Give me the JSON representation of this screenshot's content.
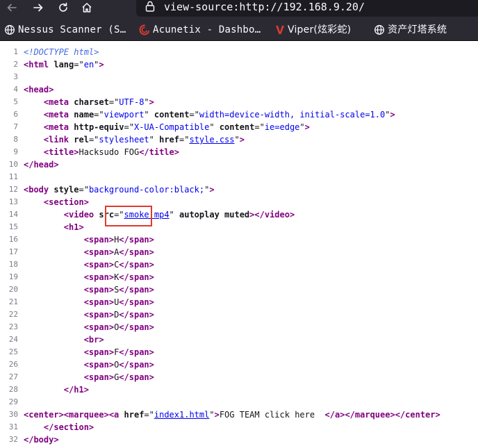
{
  "browser": {
    "url": "view-source:http://192.168.9.20/",
    "bookmarks": [
      {
        "label": "Nessus Scanner (S…",
        "icon": "globe-icon"
      },
      {
        "label": "Acunetix - Dashbo…",
        "icon": "acunetix-icon"
      },
      {
        "label": "Viper(炫彩蛇)",
        "icon": "viper-icon"
      },
      {
        "label": "资产灯塔系统",
        "icon": "globe-icon"
      }
    ]
  },
  "colors": {
    "tag": "#800080",
    "attr_value": "#0000ee",
    "doctype": "#4169e1",
    "highlight": "#e03a2f"
  },
  "source": {
    "lines": [
      {
        "n": "1",
        "tokens": [
          [
            "doctype",
            "<!DOCTYPE html>"
          ]
        ]
      },
      {
        "n": "2",
        "tokens": [
          [
            "tag",
            "<html "
          ],
          [
            "attr",
            "lang"
          ],
          [
            "txt",
            "=\""
          ],
          [
            "val",
            "en"
          ],
          [
            "txt",
            "\""
          ],
          [
            "tag",
            ">"
          ]
        ]
      },
      {
        "n": "3",
        "tokens": []
      },
      {
        "n": "4",
        "tokens": [
          [
            "tag",
            "<head>"
          ]
        ]
      },
      {
        "n": "5",
        "tokens": [
          [
            "txt",
            "    "
          ],
          [
            "tag",
            "<meta "
          ],
          [
            "attr",
            "charset"
          ],
          [
            "txt",
            "=\""
          ],
          [
            "val",
            "UTF-8"
          ],
          [
            "txt",
            "\""
          ],
          [
            "tag",
            ">"
          ]
        ]
      },
      {
        "n": "6",
        "tokens": [
          [
            "txt",
            "    "
          ],
          [
            "tag",
            "<meta "
          ],
          [
            "attr",
            "name"
          ],
          [
            "txt",
            "=\""
          ],
          [
            "val",
            "viewport"
          ],
          [
            "txt",
            "\" "
          ],
          [
            "attr",
            "content"
          ],
          [
            "txt",
            "=\""
          ],
          [
            "val",
            "width=device-width, initial-scale=1.0"
          ],
          [
            "txt",
            "\""
          ],
          [
            "tag",
            ">"
          ]
        ]
      },
      {
        "n": "7",
        "tokens": [
          [
            "txt",
            "    "
          ],
          [
            "tag",
            "<meta "
          ],
          [
            "attr",
            "http-equiv"
          ],
          [
            "txt",
            "=\""
          ],
          [
            "val",
            "X-UA-Compatible"
          ],
          [
            "txt",
            "\" "
          ],
          [
            "attr",
            "content"
          ],
          [
            "txt",
            "=\""
          ],
          [
            "val",
            "ie=edge"
          ],
          [
            "txt",
            "\""
          ],
          [
            "tag",
            ">"
          ]
        ]
      },
      {
        "n": "8",
        "tokens": [
          [
            "txt",
            "    "
          ],
          [
            "tag",
            "<link "
          ],
          [
            "attr",
            "rel"
          ],
          [
            "txt",
            "=\""
          ],
          [
            "val",
            "stylesheet"
          ],
          [
            "txt",
            "\" "
          ],
          [
            "attr",
            "href"
          ],
          [
            "txt",
            "=\""
          ],
          [
            "link",
            "style.css"
          ],
          [
            "txt",
            "\""
          ],
          [
            "tag",
            ">"
          ]
        ]
      },
      {
        "n": "9",
        "tokens": [
          [
            "txt",
            "    "
          ],
          [
            "tag",
            "<title>"
          ],
          [
            "txt",
            "Hacksudo FOG"
          ],
          [
            "tag",
            "</title>"
          ]
        ]
      },
      {
        "n": "10",
        "tokens": [
          [
            "tag",
            "</head>"
          ]
        ]
      },
      {
        "n": "11",
        "tokens": []
      },
      {
        "n": "12",
        "tokens": [
          [
            "tag",
            "<body "
          ],
          [
            "attr",
            "style"
          ],
          [
            "txt",
            "=\""
          ],
          [
            "val",
            "background-color:black;"
          ],
          [
            "txt",
            "\""
          ],
          [
            "tag",
            ">"
          ]
        ]
      },
      {
        "n": "13",
        "tokens": [
          [
            "txt",
            "    "
          ],
          [
            "tag",
            "<section>"
          ]
        ]
      },
      {
        "n": "14",
        "tokens": [
          [
            "txt",
            "        "
          ],
          [
            "tag",
            "<video "
          ],
          [
            "attr",
            "src"
          ],
          [
            "txt",
            "=\""
          ],
          [
            "link",
            "smoke.mp4"
          ],
          [
            "txt",
            "\" "
          ],
          [
            "attr",
            "autoplay muted"
          ],
          [
            "tag",
            ">"
          ],
          [
            "tag",
            "</video>"
          ]
        ]
      },
      {
        "n": "15",
        "tokens": [
          [
            "txt",
            "        "
          ],
          [
            "tag",
            "<h1>"
          ]
        ]
      },
      {
        "n": "16",
        "tokens": [
          [
            "txt",
            "            "
          ],
          [
            "tag",
            "<span>"
          ],
          [
            "txt",
            "H"
          ],
          [
            "tag",
            "</span>"
          ]
        ]
      },
      {
        "n": "17",
        "tokens": [
          [
            "txt",
            "            "
          ],
          [
            "tag",
            "<span>"
          ],
          [
            "txt",
            "A"
          ],
          [
            "tag",
            "</span>"
          ]
        ]
      },
      {
        "n": "18",
        "tokens": [
          [
            "txt",
            "            "
          ],
          [
            "tag",
            "<span>"
          ],
          [
            "txt",
            "C"
          ],
          [
            "tag",
            "</span>"
          ]
        ]
      },
      {
        "n": "19",
        "tokens": [
          [
            "txt",
            "            "
          ],
          [
            "tag",
            "<span>"
          ],
          [
            "txt",
            "K"
          ],
          [
            "tag",
            "</span>"
          ]
        ]
      },
      {
        "n": "20",
        "tokens": [
          [
            "txt",
            "            "
          ],
          [
            "tag",
            "<span>"
          ],
          [
            "txt",
            "S"
          ],
          [
            "tag",
            "</span>"
          ]
        ]
      },
      {
        "n": "21",
        "tokens": [
          [
            "txt",
            "            "
          ],
          [
            "tag",
            "<span>"
          ],
          [
            "txt",
            "U"
          ],
          [
            "tag",
            "</span>"
          ]
        ]
      },
      {
        "n": "22",
        "tokens": [
          [
            "txt",
            "            "
          ],
          [
            "tag",
            "<span>"
          ],
          [
            "txt",
            "D"
          ],
          [
            "tag",
            "</span>"
          ]
        ]
      },
      {
        "n": "23",
        "tokens": [
          [
            "txt",
            "            "
          ],
          [
            "tag",
            "<span>"
          ],
          [
            "txt",
            "O"
          ],
          [
            "tag",
            "</span>"
          ]
        ]
      },
      {
        "n": "24",
        "tokens": [
          [
            "txt",
            "            "
          ],
          [
            "tag",
            "<br>"
          ]
        ]
      },
      {
        "n": "25",
        "tokens": [
          [
            "txt",
            "            "
          ],
          [
            "tag",
            "<span>"
          ],
          [
            "txt",
            "F"
          ],
          [
            "tag",
            "</span>"
          ]
        ]
      },
      {
        "n": "26",
        "tokens": [
          [
            "txt",
            "            "
          ],
          [
            "tag",
            "<span>"
          ],
          [
            "txt",
            "O"
          ],
          [
            "tag",
            "</span>"
          ]
        ]
      },
      {
        "n": "27",
        "tokens": [
          [
            "txt",
            "            "
          ],
          [
            "tag",
            "<span>"
          ],
          [
            "txt",
            "G"
          ],
          [
            "tag",
            "</span>"
          ]
        ]
      },
      {
        "n": "28",
        "tokens": [
          [
            "txt",
            "        "
          ],
          [
            "tag",
            "</h1>"
          ]
        ]
      },
      {
        "n": "29",
        "tokens": []
      },
      {
        "n": "30",
        "tokens": [
          [
            "tag",
            "<center>"
          ],
          [
            "tag",
            "<marquee>"
          ],
          [
            "tag",
            "<a "
          ],
          [
            "attr",
            "href"
          ],
          [
            "txt",
            "=\""
          ],
          [
            "link",
            "index1.html"
          ],
          [
            "txt",
            "\""
          ],
          [
            "tag",
            ">"
          ],
          [
            "txt",
            "FOG TEAM click here  "
          ],
          [
            "tag",
            "</a>"
          ],
          [
            "tag",
            "</marquee>"
          ],
          [
            "tag",
            "</center>"
          ]
        ]
      },
      {
        "n": "31",
        "tokens": [
          [
            "txt",
            "    "
          ],
          [
            "tag",
            "</section>"
          ]
        ]
      },
      {
        "n": "32",
        "tokens": [
          [
            "tag",
            "</body>"
          ]
        ]
      }
    ]
  }
}
